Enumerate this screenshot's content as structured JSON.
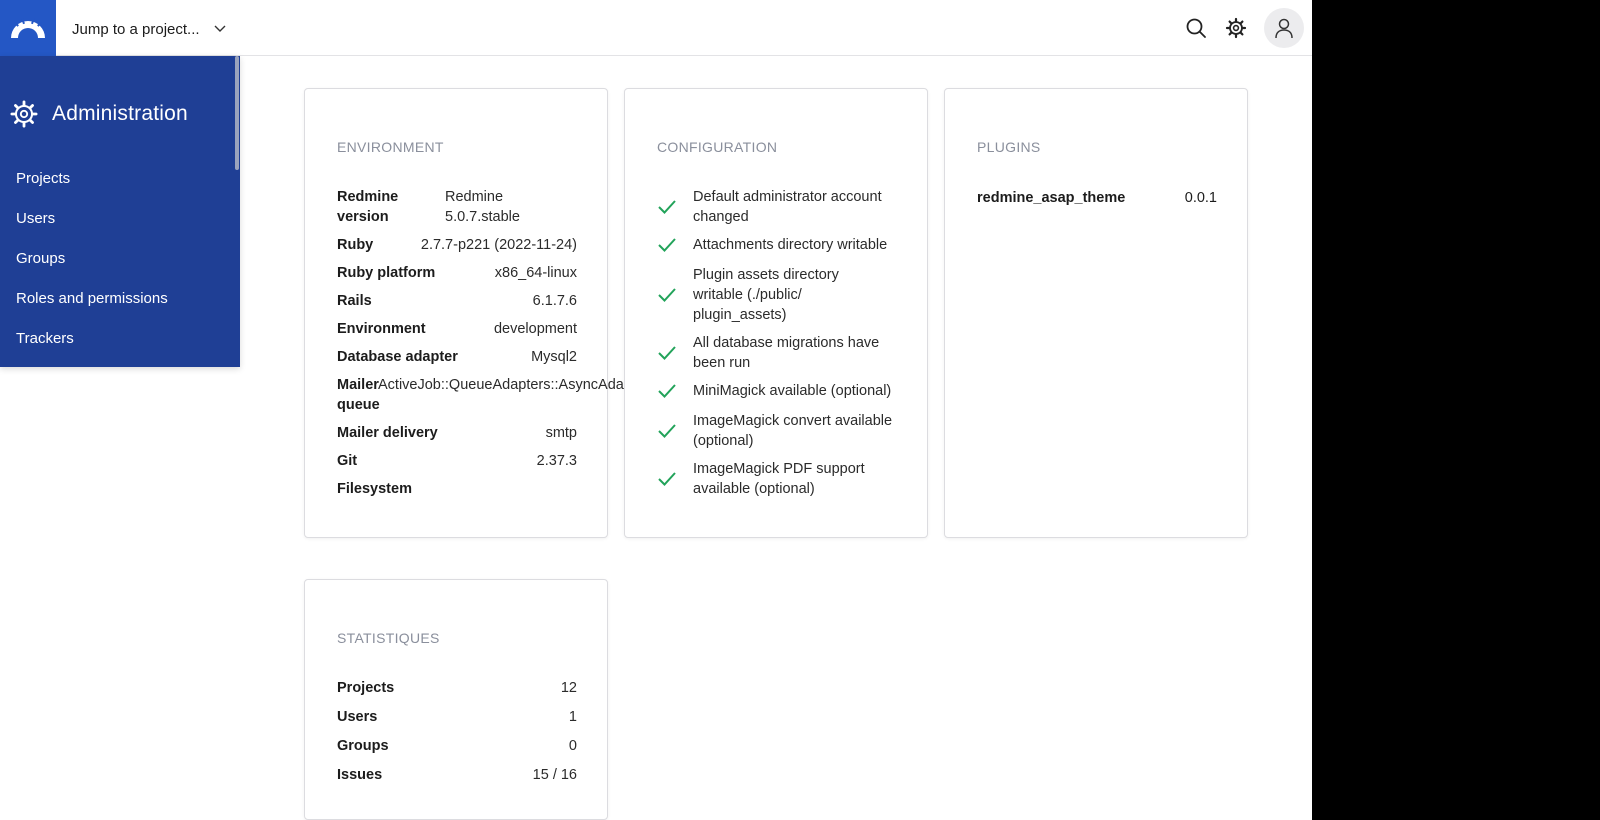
{
  "topbar": {
    "jump_label": "Jump to a project..."
  },
  "icons": {
    "logo": "redmine-logo-icon",
    "search": "search-icon",
    "settings": "gear-icon",
    "user": "user-icon",
    "check": "check-icon",
    "chevron": "chevron-down-icon"
  },
  "colors": {
    "brand": "#2457c5",
    "sidebar": "#1f3f95",
    "check": "#22a35a"
  },
  "sidebar": {
    "title": "Administration",
    "items": [
      {
        "label": "Projects"
      },
      {
        "label": "Users"
      },
      {
        "label": "Groups"
      },
      {
        "label": "Roles and permissions"
      },
      {
        "label": "Trackers"
      }
    ]
  },
  "environment": {
    "title": "ENVIRONMENT",
    "rows": [
      {
        "key": "Redmine version",
        "value": "Redmine 5.0.7.stable"
      },
      {
        "key": "Ruby",
        "value": "2.7.7-p221 (2022-11-24)"
      },
      {
        "key": "Ruby platform",
        "value": "x86_64-linux"
      },
      {
        "key": "Rails",
        "value": "6.1.7.6"
      },
      {
        "key": "Environment",
        "value": "development"
      },
      {
        "key": "Database adapter",
        "value": "Mysql2"
      },
      {
        "key": "Mailer queue",
        "value": "ActiveJob::QueueAdapters::AsyncAdapter"
      },
      {
        "key": "Mailer delivery",
        "value": "smtp"
      },
      {
        "key": "Git",
        "value": "2.37.3"
      },
      {
        "key": "Filesystem",
        "value": ""
      }
    ]
  },
  "configuration": {
    "title": "CONFIGURATION",
    "items": [
      {
        "label": "Default administrator account changed"
      },
      {
        "label": "Attachments directory writable"
      },
      {
        "label": "Plugin assets directory writable (./public/ plugin_assets)"
      },
      {
        "label": "All database migrations have been run"
      },
      {
        "label": "MiniMagick available (optional)"
      },
      {
        "label": "ImageMagick convert available (optional)"
      },
      {
        "label": "ImageMagick PDF support available (optional)"
      }
    ]
  },
  "plugins": {
    "title": "PLUGINS",
    "items": [
      {
        "name": "redmine_asap_theme",
        "version": "0.0.1"
      }
    ]
  },
  "statistics": {
    "title": "STATISTIQUES",
    "rows": [
      {
        "key": "Projects",
        "value": "12"
      },
      {
        "key": "Users",
        "value": "1"
      },
      {
        "key": "Groups",
        "value": "0"
      },
      {
        "key": "Issues",
        "value": "15 / 16"
      }
    ]
  }
}
